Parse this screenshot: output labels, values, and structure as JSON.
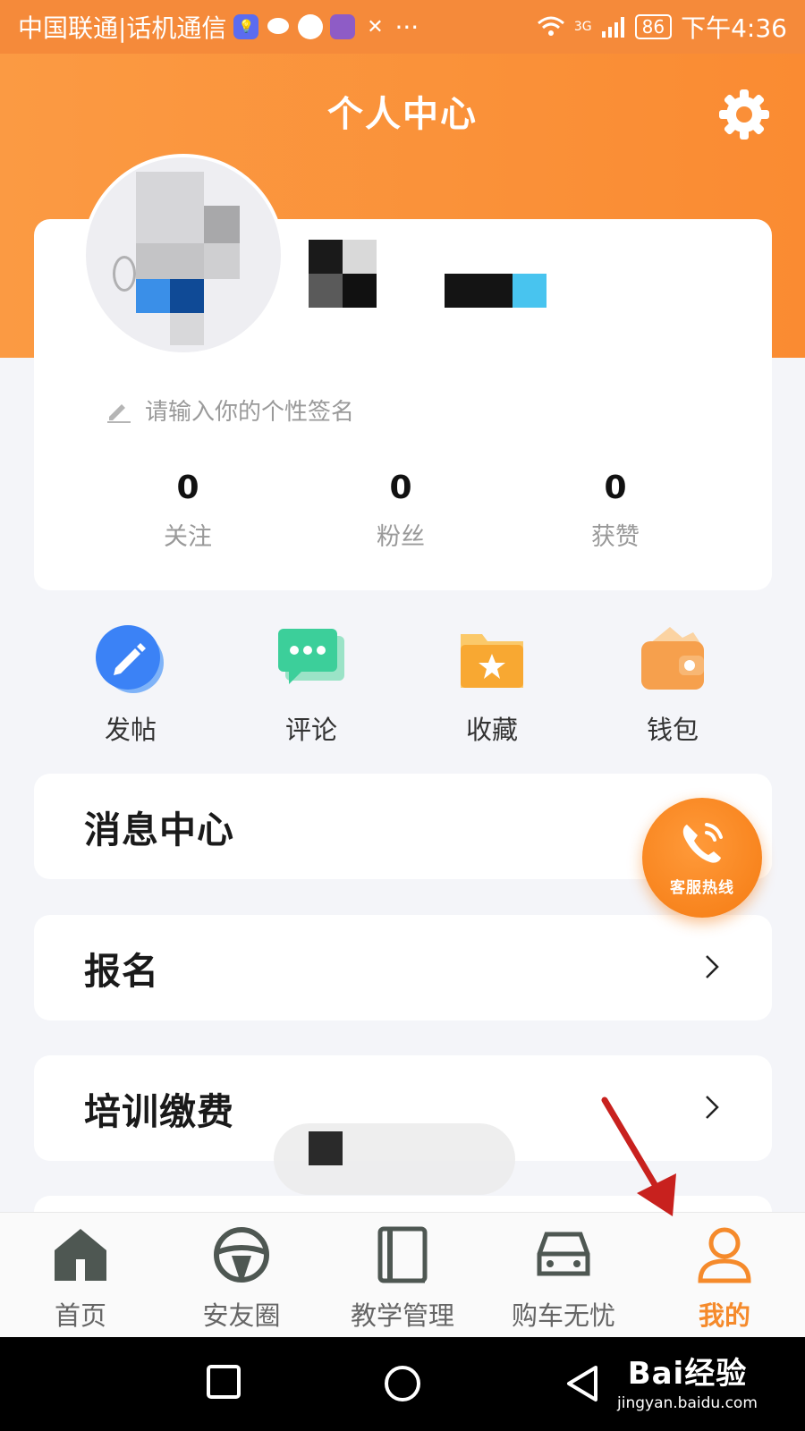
{
  "status_bar": {
    "carrier": "中国联通|话机通信",
    "network": "3G",
    "battery": "86",
    "time": "下午4:36",
    "more": "···"
  },
  "header": {
    "title": "个人中心"
  },
  "profile": {
    "signature_placeholder": "请输入你的个性签名",
    "stats": [
      {
        "value": "0",
        "label": "关注"
      },
      {
        "value": "0",
        "label": "粉丝"
      },
      {
        "value": "0",
        "label": "获赞"
      }
    ]
  },
  "quick_actions": [
    {
      "label": "发帖",
      "icon": "pencil-icon",
      "color": "#3b82f6"
    },
    {
      "label": "评论",
      "icon": "comment-icon",
      "color": "#3ccf9a"
    },
    {
      "label": "收藏",
      "icon": "star-folder-icon",
      "color": "#f7b733"
    },
    {
      "label": "钱包",
      "icon": "wallet-icon",
      "color": "#f6a04d"
    }
  ],
  "menu": [
    {
      "label": "消息中心"
    },
    {
      "label": "报名"
    },
    {
      "label": "培训缴费"
    }
  ],
  "hotline": {
    "label": "客服热线"
  },
  "bottom_nav": [
    {
      "label": "首页",
      "icon": "home-icon"
    },
    {
      "label": "安友圈",
      "icon": "steering-wheel-icon"
    },
    {
      "label": "教学管理",
      "icon": "book-icon"
    },
    {
      "label": "购车无忧",
      "icon": "car-icon"
    },
    {
      "label": "我的",
      "icon": "user-icon",
      "active": true
    }
  ],
  "colors": {
    "brand": "#f58a2b",
    "header": "#fa8f38",
    "background": "#f4f5f9"
  },
  "watermark": {
    "brand": "Bai经验",
    "url": "jingyan.baidu.com"
  }
}
